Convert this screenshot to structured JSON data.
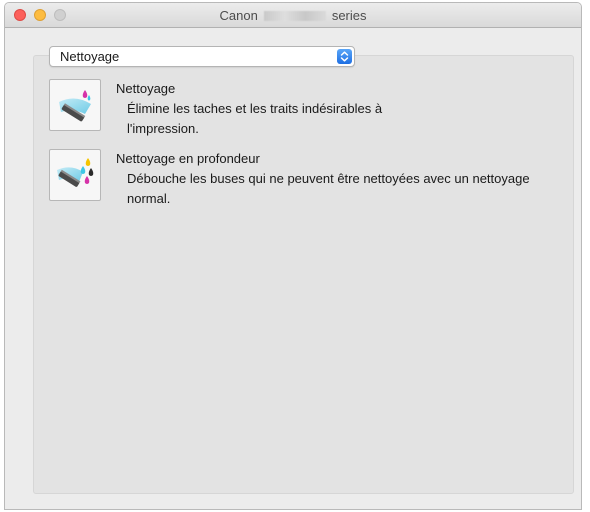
{
  "window": {
    "title_prefix": "Canon",
    "title_suffix": "series"
  },
  "function_select": {
    "value": "Nettoyage"
  },
  "tools": [
    {
      "name": "Nettoyage",
      "description": "Élimine les taches et les traits indésirables à l'impression.",
      "icon": "cleaning-icon"
    },
    {
      "name": "Nettoyage en profondeur",
      "description": "Débouche les buses qui ne peuvent être nettoyées avec un nettoyage normal.",
      "icon": "deep-cleaning-icon"
    }
  ],
  "colors": {
    "accent": "#1e6fe3",
    "ink_cyan": "#3fc7e6",
    "ink_magenta": "#d633a8",
    "ink_yellow": "#f5c400",
    "ink_black": "#2b2b2b"
  }
}
